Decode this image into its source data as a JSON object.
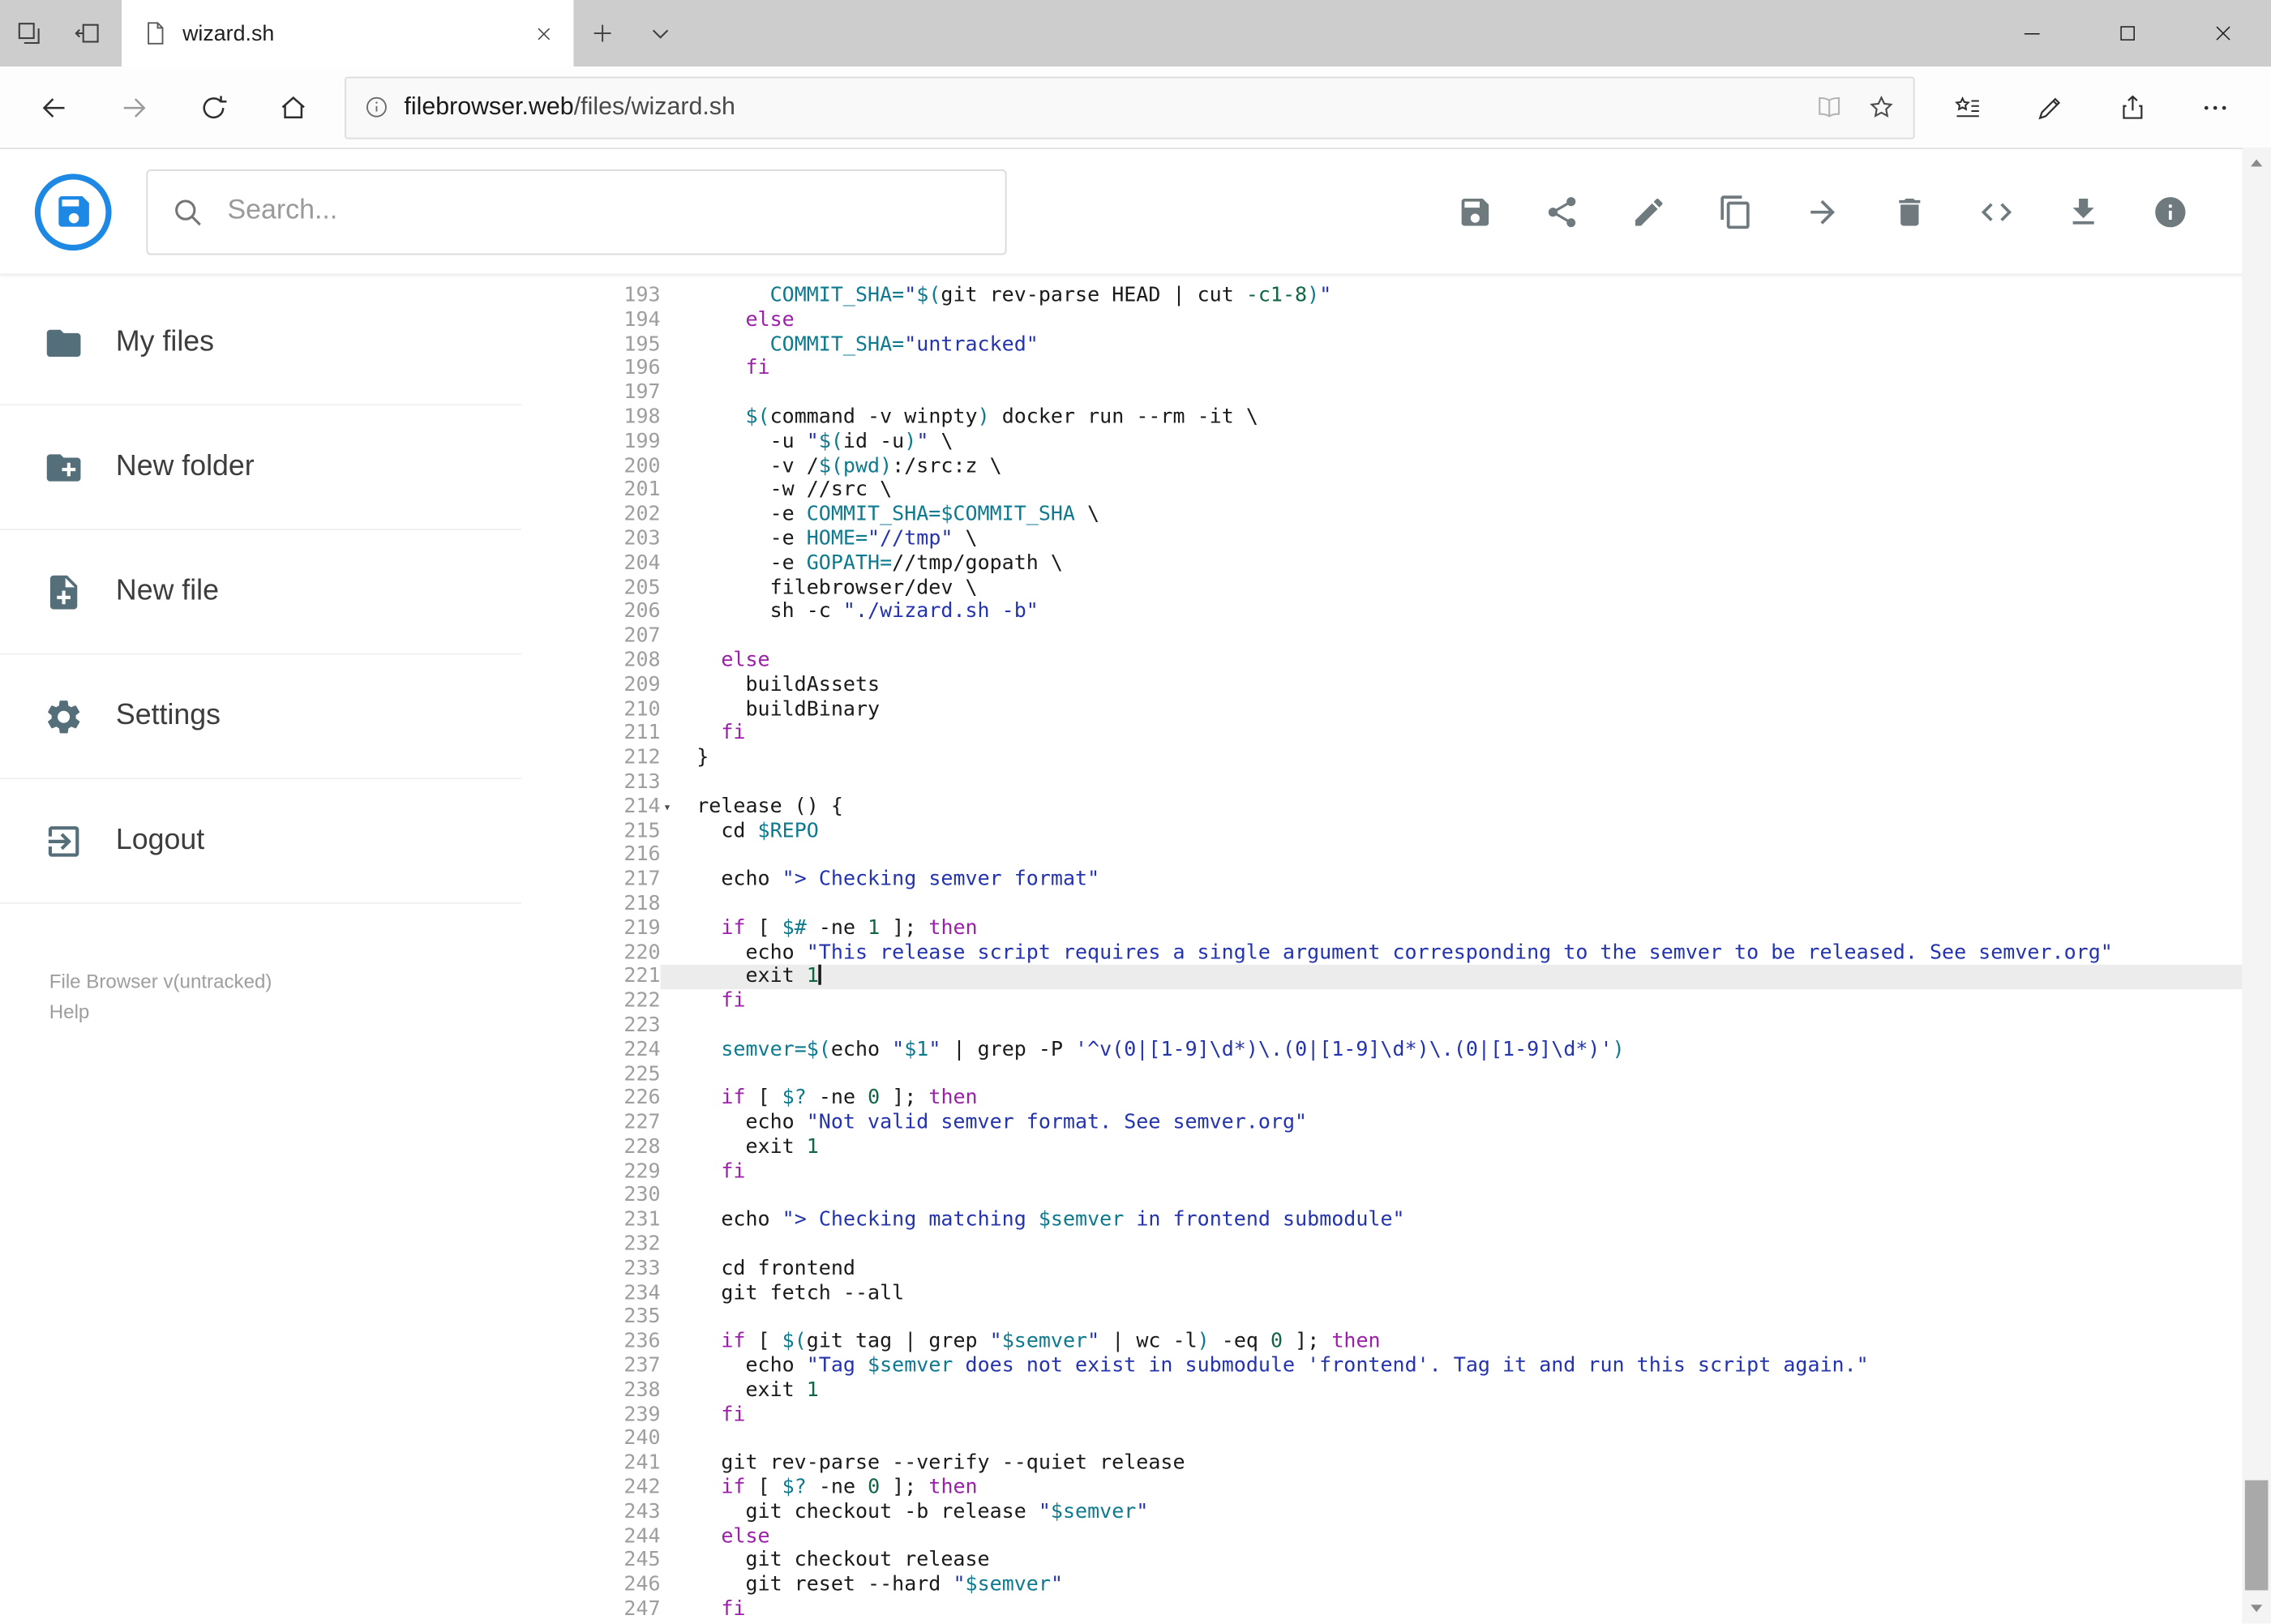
{
  "browser": {
    "tab_title": "wizard.sh",
    "url_domain": "filebrowser.web",
    "url_path": "/files/wizard.sh"
  },
  "header": {
    "search_placeholder": "Search...",
    "actions": [
      "save",
      "share",
      "rename",
      "copy",
      "move",
      "delete",
      "raw",
      "download",
      "info"
    ]
  },
  "sidebar": {
    "items": [
      {
        "label": "My files",
        "icon": "folder"
      },
      {
        "label": "New folder",
        "icon": "create-new-folder"
      },
      {
        "label": "New file",
        "icon": "new-file"
      },
      {
        "label": "Settings",
        "icon": "settings"
      },
      {
        "label": "Logout",
        "icon": "logout"
      }
    ],
    "footer": {
      "version": "File Browser v(untracked)",
      "help": "Help"
    }
  },
  "editor": {
    "active_line": 221,
    "colors": {
      "keyword": "#9b1fa8",
      "string": "#2433ae",
      "variable": "#0e7a8f",
      "number": "#116644",
      "text": "#1a1a1a",
      "active_line_bg": "#ececec",
      "line_number": "#9e9e9e"
    },
    "lines": [
      {
        "n": 193,
        "seg": [
          [
            "t",
            "      "
          ],
          [
            "v",
            "COMMIT_SHA="
          ],
          [
            "s",
            "\""
          ],
          [
            "v",
            "$("
          ],
          [
            "t",
            "git rev-parse HEAD | cut "
          ],
          [
            "n",
            "-c1-8"
          ],
          [
            "v",
            ")"
          ],
          [
            "s",
            "\""
          ]
        ]
      },
      {
        "n": 194,
        "seg": [
          [
            "t",
            "    "
          ],
          [
            "k",
            "else"
          ]
        ]
      },
      {
        "n": 195,
        "seg": [
          [
            "t",
            "      "
          ],
          [
            "v",
            "COMMIT_SHA="
          ],
          [
            "s",
            "\"untracked\""
          ]
        ]
      },
      {
        "n": 196,
        "seg": [
          [
            "t",
            "    "
          ],
          [
            "k",
            "fi"
          ]
        ]
      },
      {
        "n": 197,
        "seg": []
      },
      {
        "n": 198,
        "seg": [
          [
            "t",
            "    "
          ],
          [
            "v",
            "$("
          ],
          [
            "t",
            "command -v winpty"
          ],
          [
            "v",
            ")"
          ],
          [
            "t",
            " docker run --rm -it \\"
          ]
        ]
      },
      {
        "n": 199,
        "seg": [
          [
            "t",
            "      -u "
          ],
          [
            "s",
            "\""
          ],
          [
            "v",
            "$("
          ],
          [
            "t",
            "id -u"
          ],
          [
            "v",
            ")"
          ],
          [
            "s",
            "\""
          ],
          [
            "t",
            " \\"
          ]
        ]
      },
      {
        "n": 200,
        "seg": [
          [
            "t",
            "      -v /"
          ],
          [
            "v",
            "$(pwd)"
          ],
          [
            "t",
            ":/src:z \\"
          ]
        ]
      },
      {
        "n": 201,
        "seg": [
          [
            "t",
            "      -w //src \\"
          ]
        ]
      },
      {
        "n": 202,
        "seg": [
          [
            "t",
            "      -e "
          ],
          [
            "v",
            "COMMIT_SHA=$COMMIT_SHA"
          ],
          [
            "t",
            " \\"
          ]
        ]
      },
      {
        "n": 203,
        "seg": [
          [
            "t",
            "      -e "
          ],
          [
            "v",
            "HOME="
          ],
          [
            "s",
            "\"//tmp\""
          ],
          [
            "t",
            " \\"
          ]
        ]
      },
      {
        "n": 204,
        "seg": [
          [
            "t",
            "      -e "
          ],
          [
            "v",
            "GOPATH="
          ],
          [
            "t",
            "//tmp/gopath \\"
          ]
        ]
      },
      {
        "n": 205,
        "seg": [
          [
            "t",
            "      filebrowser/dev \\"
          ]
        ]
      },
      {
        "n": 206,
        "seg": [
          [
            "t",
            "      sh -c "
          ],
          [
            "s",
            "\"./wizard.sh -b\""
          ]
        ]
      },
      {
        "n": 207,
        "seg": []
      },
      {
        "n": 208,
        "seg": [
          [
            "t",
            "  "
          ],
          [
            "k",
            "else"
          ]
        ]
      },
      {
        "n": 209,
        "seg": [
          [
            "t",
            "    buildAssets"
          ]
        ]
      },
      {
        "n": 210,
        "seg": [
          [
            "t",
            "    buildBinary"
          ]
        ]
      },
      {
        "n": 211,
        "seg": [
          [
            "t",
            "  "
          ],
          [
            "k",
            "fi"
          ]
        ]
      },
      {
        "n": 212,
        "seg": [
          [
            "t",
            "}"
          ]
        ]
      },
      {
        "n": 213,
        "seg": []
      },
      {
        "n": 214,
        "fold": true,
        "seg": [
          [
            "t",
            "release () {"
          ]
        ]
      },
      {
        "n": 215,
        "seg": [
          [
            "t",
            "  cd "
          ],
          [
            "v",
            "$REPO"
          ]
        ]
      },
      {
        "n": 216,
        "seg": []
      },
      {
        "n": 217,
        "seg": [
          [
            "t",
            "  echo "
          ],
          [
            "s",
            "\"> Checking semver format\""
          ]
        ]
      },
      {
        "n": 218,
        "seg": []
      },
      {
        "n": 219,
        "seg": [
          [
            "t",
            "  "
          ],
          [
            "k",
            "if"
          ],
          [
            "t",
            " [ "
          ],
          [
            "v",
            "$#"
          ],
          [
            "t",
            " -ne "
          ],
          [
            "n",
            "1"
          ],
          [
            "t",
            " ]; "
          ],
          [
            "k",
            "then"
          ]
        ]
      },
      {
        "n": 220,
        "seg": [
          [
            "t",
            "    echo "
          ],
          [
            "s",
            "\"This release script requires a single argument corresponding to the semver to be released. See semver.org\""
          ]
        ]
      },
      {
        "n": 221,
        "seg": [
          [
            "t",
            "    exit "
          ],
          [
            "n",
            "1"
          ]
        ]
      },
      {
        "n": 222,
        "seg": [
          [
            "t",
            "  "
          ],
          [
            "k",
            "fi"
          ]
        ]
      },
      {
        "n": 223,
        "seg": []
      },
      {
        "n": 224,
        "seg": [
          [
            "t",
            "  "
          ],
          [
            "v",
            "semver=$("
          ],
          [
            "t",
            "echo "
          ],
          [
            "s",
            "\""
          ],
          [
            "v",
            "$1"
          ],
          [
            "s",
            "\""
          ],
          [
            "t",
            " | grep -P "
          ],
          [
            "s",
            "'^v(0|[1-9]\\d*)\\.(0|[1-9]\\d*)\\.(0|[1-9]\\d*)'"
          ],
          [
            "v",
            ")"
          ]
        ]
      },
      {
        "n": 225,
        "seg": []
      },
      {
        "n": 226,
        "seg": [
          [
            "t",
            "  "
          ],
          [
            "k",
            "if"
          ],
          [
            "t",
            " [ "
          ],
          [
            "v",
            "$?"
          ],
          [
            "t",
            " -ne "
          ],
          [
            "n",
            "0"
          ],
          [
            "t",
            " ]; "
          ],
          [
            "k",
            "then"
          ]
        ]
      },
      {
        "n": 227,
        "seg": [
          [
            "t",
            "    echo "
          ],
          [
            "s",
            "\"Not valid semver format. See semver.org\""
          ]
        ]
      },
      {
        "n": 228,
        "seg": [
          [
            "t",
            "    exit "
          ],
          [
            "n",
            "1"
          ]
        ]
      },
      {
        "n": 229,
        "seg": [
          [
            "t",
            "  "
          ],
          [
            "k",
            "fi"
          ]
        ]
      },
      {
        "n": 230,
        "seg": []
      },
      {
        "n": 231,
        "seg": [
          [
            "t",
            "  echo "
          ],
          [
            "s",
            "\"> Checking matching "
          ],
          [
            "v",
            "$semver"
          ],
          [
            "s",
            " in frontend submodule\""
          ]
        ]
      },
      {
        "n": 232,
        "seg": []
      },
      {
        "n": 233,
        "seg": [
          [
            "t",
            "  cd frontend"
          ]
        ]
      },
      {
        "n": 234,
        "seg": [
          [
            "t",
            "  git fetch --all"
          ]
        ]
      },
      {
        "n": 235,
        "seg": []
      },
      {
        "n": 236,
        "seg": [
          [
            "t",
            "  "
          ],
          [
            "k",
            "if"
          ],
          [
            "t",
            " [ "
          ],
          [
            "v",
            "$("
          ],
          [
            "t",
            "git tag | grep "
          ],
          [
            "s",
            "\""
          ],
          [
            "v",
            "$semver"
          ],
          [
            "s",
            "\""
          ],
          [
            "t",
            " | wc -l"
          ],
          [
            "v",
            ")"
          ],
          [
            "t",
            " -eq "
          ],
          [
            "n",
            "0"
          ],
          [
            "t",
            " ]; "
          ],
          [
            "k",
            "then"
          ]
        ]
      },
      {
        "n": 237,
        "seg": [
          [
            "t",
            "    echo "
          ],
          [
            "s",
            "\"Tag "
          ],
          [
            "v",
            "$semver"
          ],
          [
            "s",
            " does not exist in submodule 'frontend'. Tag it and run this script again.\""
          ]
        ]
      },
      {
        "n": 238,
        "seg": [
          [
            "t",
            "    exit "
          ],
          [
            "n",
            "1"
          ]
        ]
      },
      {
        "n": 239,
        "seg": [
          [
            "t",
            "  "
          ],
          [
            "k",
            "fi"
          ]
        ]
      },
      {
        "n": 240,
        "seg": []
      },
      {
        "n": 241,
        "seg": [
          [
            "t",
            "  git rev-parse --verify --quiet release"
          ]
        ]
      },
      {
        "n": 242,
        "seg": [
          [
            "t",
            "  "
          ],
          [
            "k",
            "if"
          ],
          [
            "t",
            " [ "
          ],
          [
            "v",
            "$?"
          ],
          [
            "t",
            " -ne "
          ],
          [
            "n",
            "0"
          ],
          [
            "t",
            " ]; "
          ],
          [
            "k",
            "then"
          ]
        ]
      },
      {
        "n": 243,
        "seg": [
          [
            "t",
            "    git checkout -b release "
          ],
          [
            "s",
            "\""
          ],
          [
            "v",
            "$semver"
          ],
          [
            "s",
            "\""
          ]
        ]
      },
      {
        "n": 244,
        "seg": [
          [
            "t",
            "  "
          ],
          [
            "k",
            "else"
          ]
        ]
      },
      {
        "n": 245,
        "seg": [
          [
            "t",
            "    git checkout release"
          ]
        ]
      },
      {
        "n": 246,
        "seg": [
          [
            "t",
            "    git reset --hard "
          ],
          [
            "s",
            "\""
          ],
          [
            "v",
            "$semver"
          ],
          [
            "s",
            "\""
          ]
        ]
      },
      {
        "n": 247,
        "seg": [
          [
            "t",
            "  "
          ],
          [
            "k",
            "fi"
          ]
        ]
      }
    ]
  }
}
